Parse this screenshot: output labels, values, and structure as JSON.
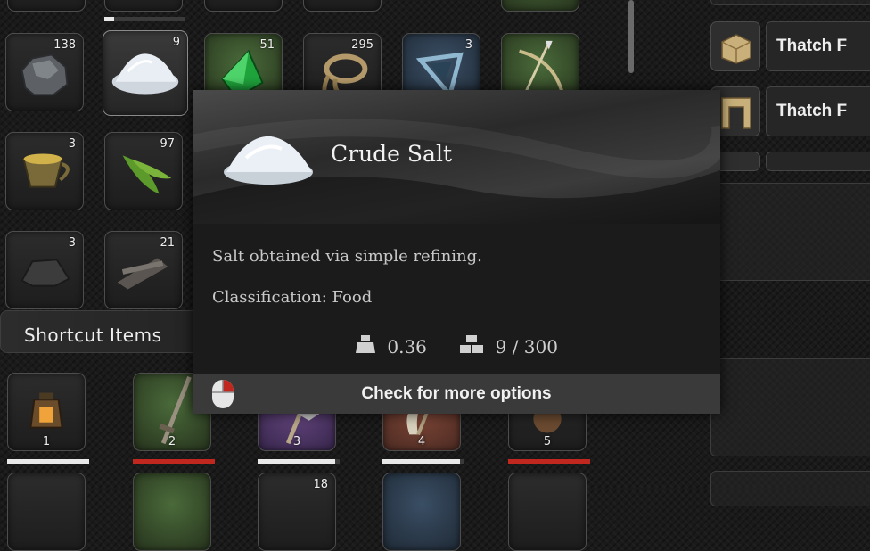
{
  "inventory": {
    "slots": [
      {
        "name": "stone",
        "qty": "138"
      },
      {
        "name": "crude-salt",
        "qty": "9"
      },
      {
        "name": "green-gem",
        "qty": "51"
      },
      {
        "name": "rope",
        "qty": "295"
      },
      {
        "name": "crystal",
        "qty": "3"
      },
      {
        "name": "bow",
        "qty": ""
      },
      {
        "name": "cup",
        "qty": "3"
      },
      {
        "name": "leaves",
        "qty": "97"
      },
      {
        "name": "ore",
        "qty": "3"
      },
      {
        "name": "wood",
        "qty": "21"
      }
    ]
  },
  "tooltip": {
    "item_name": "Crude Salt",
    "description": "Salt obtained via simple refining.",
    "classification": "Classification: Food",
    "weight": "0.36",
    "stack": "9 / 300",
    "footer_label": "Check for more options"
  },
  "shortcut": {
    "title": "Shortcut Items",
    "slots": [
      {
        "num": "1",
        "durability": 1.0,
        "bar_color": "#e8e8e8"
      },
      {
        "num": "2",
        "durability": 1.0,
        "bar_color": "#c0271f"
      },
      {
        "num": "3",
        "durability": 0.95,
        "bar_color": "#e8e8e8"
      },
      {
        "num": "4",
        "durability": 0.95,
        "bar_color": "#e8e8e8"
      },
      {
        "num": "5",
        "durability": 1.0,
        "bar_color": "#c0271f"
      }
    ],
    "partial_qty": "18"
  },
  "build_menu": {
    "items": [
      {
        "label": "Thatch F"
      },
      {
        "label": "Thatch F"
      }
    ]
  },
  "colors": {
    "accent_red": "#c0271f",
    "bar_white": "#e8e8e8"
  }
}
